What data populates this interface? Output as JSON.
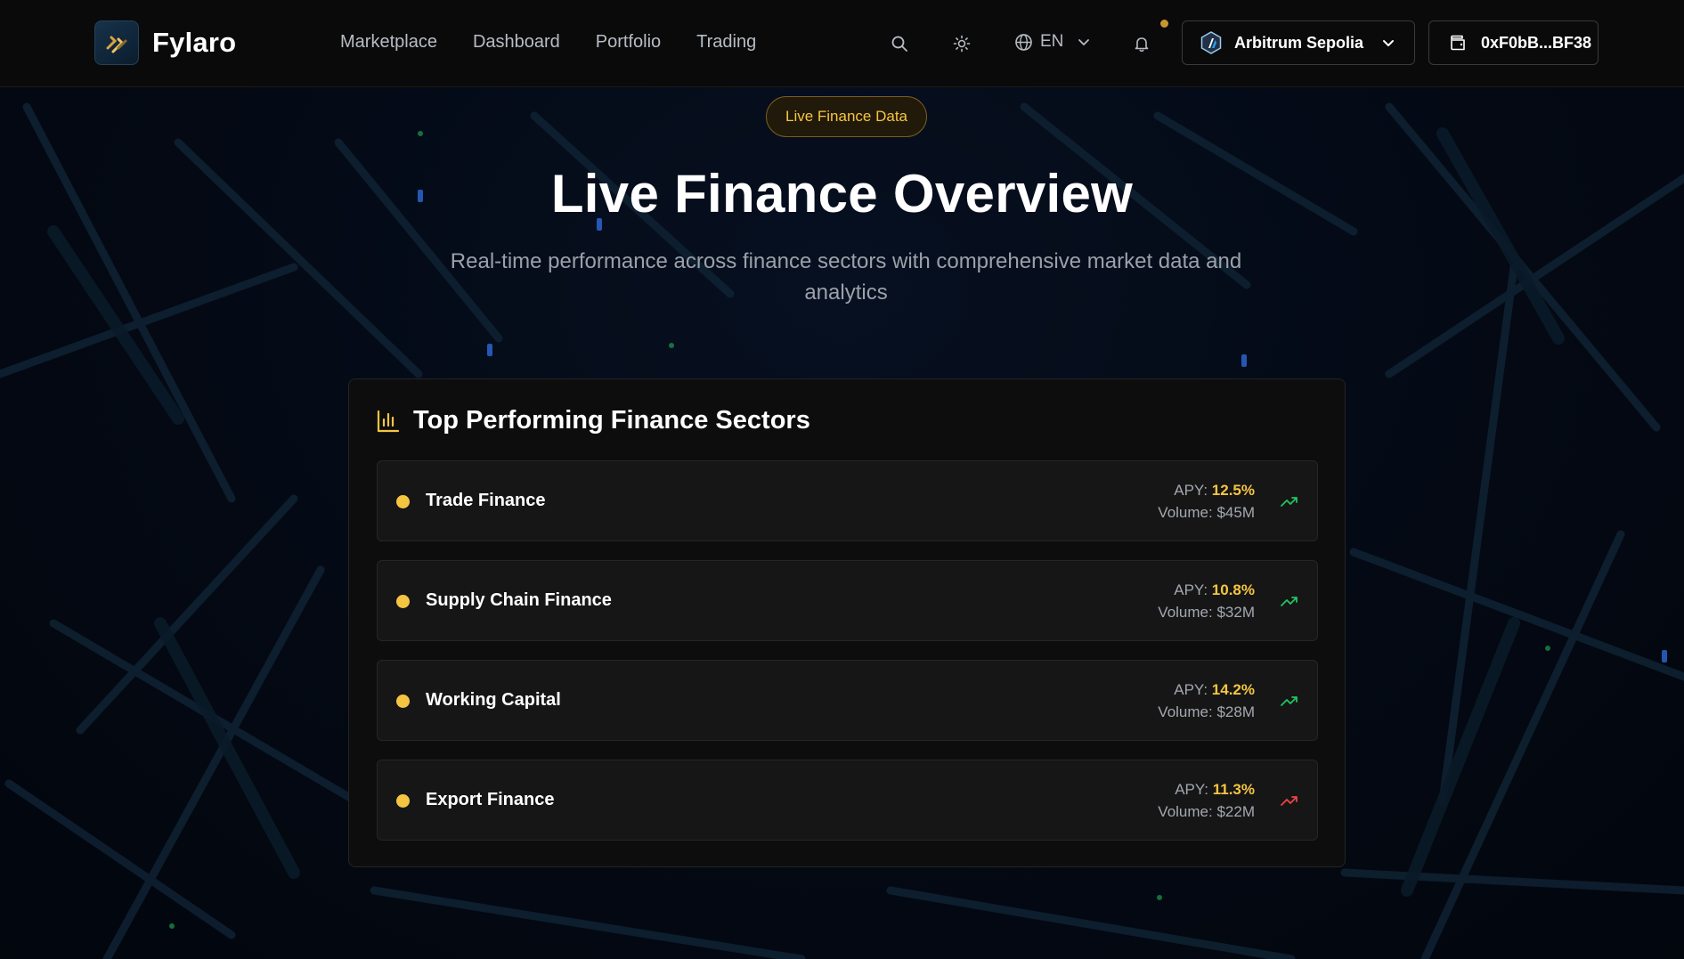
{
  "header": {
    "brand": "Fylaro",
    "nav": [
      "Marketplace",
      "Dashboard",
      "Portfolio",
      "Trading"
    ],
    "icons": {
      "search": "search-icon",
      "theme": "sun-icon",
      "language": "globe-icon",
      "notifications": "bell-icon"
    },
    "language": "EN",
    "network": "Arbitrum Sepolia",
    "wallet": "0xF0bB...BF38"
  },
  "hero": {
    "badge": "Live Finance Data",
    "title": "Live Finance Overview",
    "subtitle": "Real-time performance across finance sectors with comprehensive market data and analytics"
  },
  "sectors_card": {
    "title": "Top Performing Finance Sectors",
    "icon": "bar-chart-icon",
    "apy_prefix": "APY:",
    "volume_prefix": "Volume:",
    "items": [
      {
        "name": "Trade Finance",
        "apy": "12.5%",
        "volume": "$45M",
        "trend": "up",
        "trend_color": "#22c55e"
      },
      {
        "name": "Supply Chain Finance",
        "apy": "10.8%",
        "volume": "$32M",
        "trend": "up",
        "trend_color": "#22c55e"
      },
      {
        "name": "Working Capital",
        "apy": "14.2%",
        "volume": "$28M",
        "trend": "up",
        "trend_color": "#22c55e"
      },
      {
        "name": "Export Finance",
        "apy": "11.3%",
        "volume": "$22M",
        "trend": "up",
        "trend_color": "#ef4444"
      }
    ]
  },
  "colors": {
    "accent": "#f5c542",
    "background": "#03070f",
    "card": "#0d0d0e"
  }
}
